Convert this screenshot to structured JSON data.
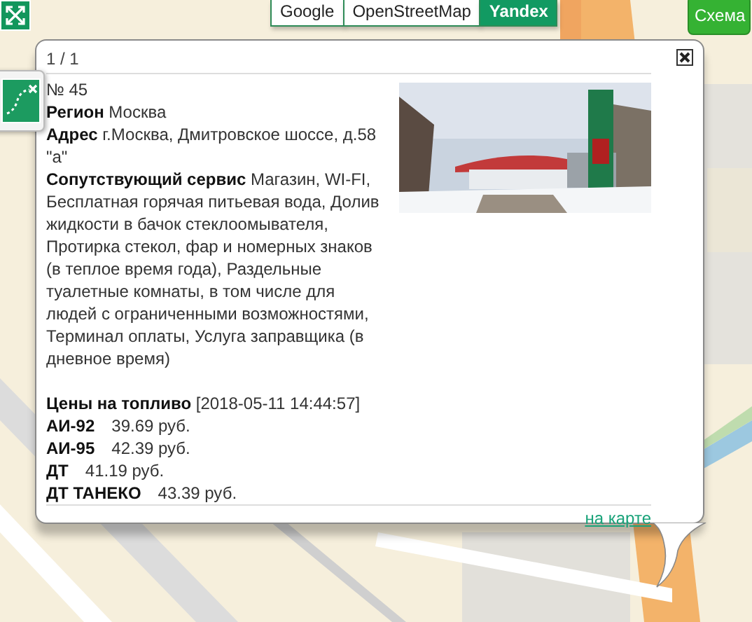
{
  "map_tabs": [
    {
      "label": "Google",
      "selected": false
    },
    {
      "label": "OpenStreetMap",
      "selected": false
    },
    {
      "label": "Yandex",
      "selected": true
    }
  ],
  "scheme_button": "Схема",
  "popup": {
    "counter": "1 / 1",
    "fields": [
      "№ 45",
      "**Регион** Москва",
      "**Адрес** г.Москва, Дмитровское шоссе, д.58 \"а\"",
      "**Сопутствующий сервис** Магазин, WI-FI, Бесплатная горячая питьевая вода, Долив жидкости в бачок стеклоомывателя, Протирка стекол, фар и номерных знаков (в теплое время года), Раздельные туалетные комнаты, в том числе для людей с ограниченными возможностями, Терминал оплаты, Услуга заправщика (в дневное время)"
    ],
    "prices_heading": "**Цены на топливо** [2018-05-11 14:44:57]",
    "prices": [
      {
        "fuel": "АИ-92",
        "price": "39.69 руб."
      },
      {
        "fuel": "АИ-95",
        "price": "42.39 руб."
      },
      {
        "fuel": "ДТ",
        "price": "41.19 руб."
      },
      {
        "fuel": "ДТ ТАНЕКО",
        "price": "43.39 руб."
      }
    ],
    "map_link": "на карте"
  }
}
